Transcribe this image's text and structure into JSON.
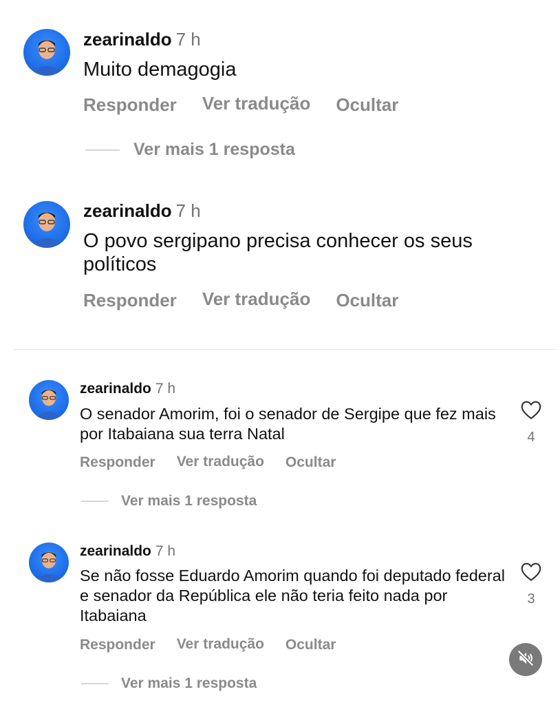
{
  "comments": [
    {
      "username": "zearinaldo",
      "time": "7 h",
      "text": "Muito demagogia",
      "actions": {
        "reply": "Responder",
        "translate": "Ver tradução",
        "hide": "Ocultar"
      },
      "more_replies": "Ver mais 1 resposta"
    },
    {
      "username": "zearinaldo",
      "time": "7 h",
      "text": "O povo sergipano precisa conhecer os seus políticos",
      "actions": {
        "reply": "Responder",
        "translate": "Ver tradução",
        "hide": "Ocultar"
      }
    },
    {
      "username": "zearinaldo",
      "time": "7 h",
      "text": "O senador Amorim, foi o senador de Sergipe que fez mais por Itabaiana sua terra Natal",
      "actions": {
        "reply": "Responder",
        "translate": "Ver tradução",
        "hide": "Ocultar"
      },
      "likes": "4",
      "more_replies": "Ver mais 1 resposta"
    },
    {
      "username": "zearinaldo",
      "time": "7 h",
      "text": "Se não fosse Eduardo Amorim quando foi deputado federal e senador da República ele não teria feito nada por Itabaiana",
      "actions": {
        "reply": "Responder",
        "translate": "Ver tradução",
        "hide": "Ocultar"
      },
      "likes": "3",
      "more_replies": "Ver mais 1 resposta"
    }
  ],
  "icons": {
    "like": "heart-outline-icon",
    "mute": "speaker-muted-icon"
  },
  "colors": {
    "avatar_bg": "#1f6fe8",
    "secondary_text": "#8a8a8a",
    "mute_button": "#7a7a7a"
  }
}
